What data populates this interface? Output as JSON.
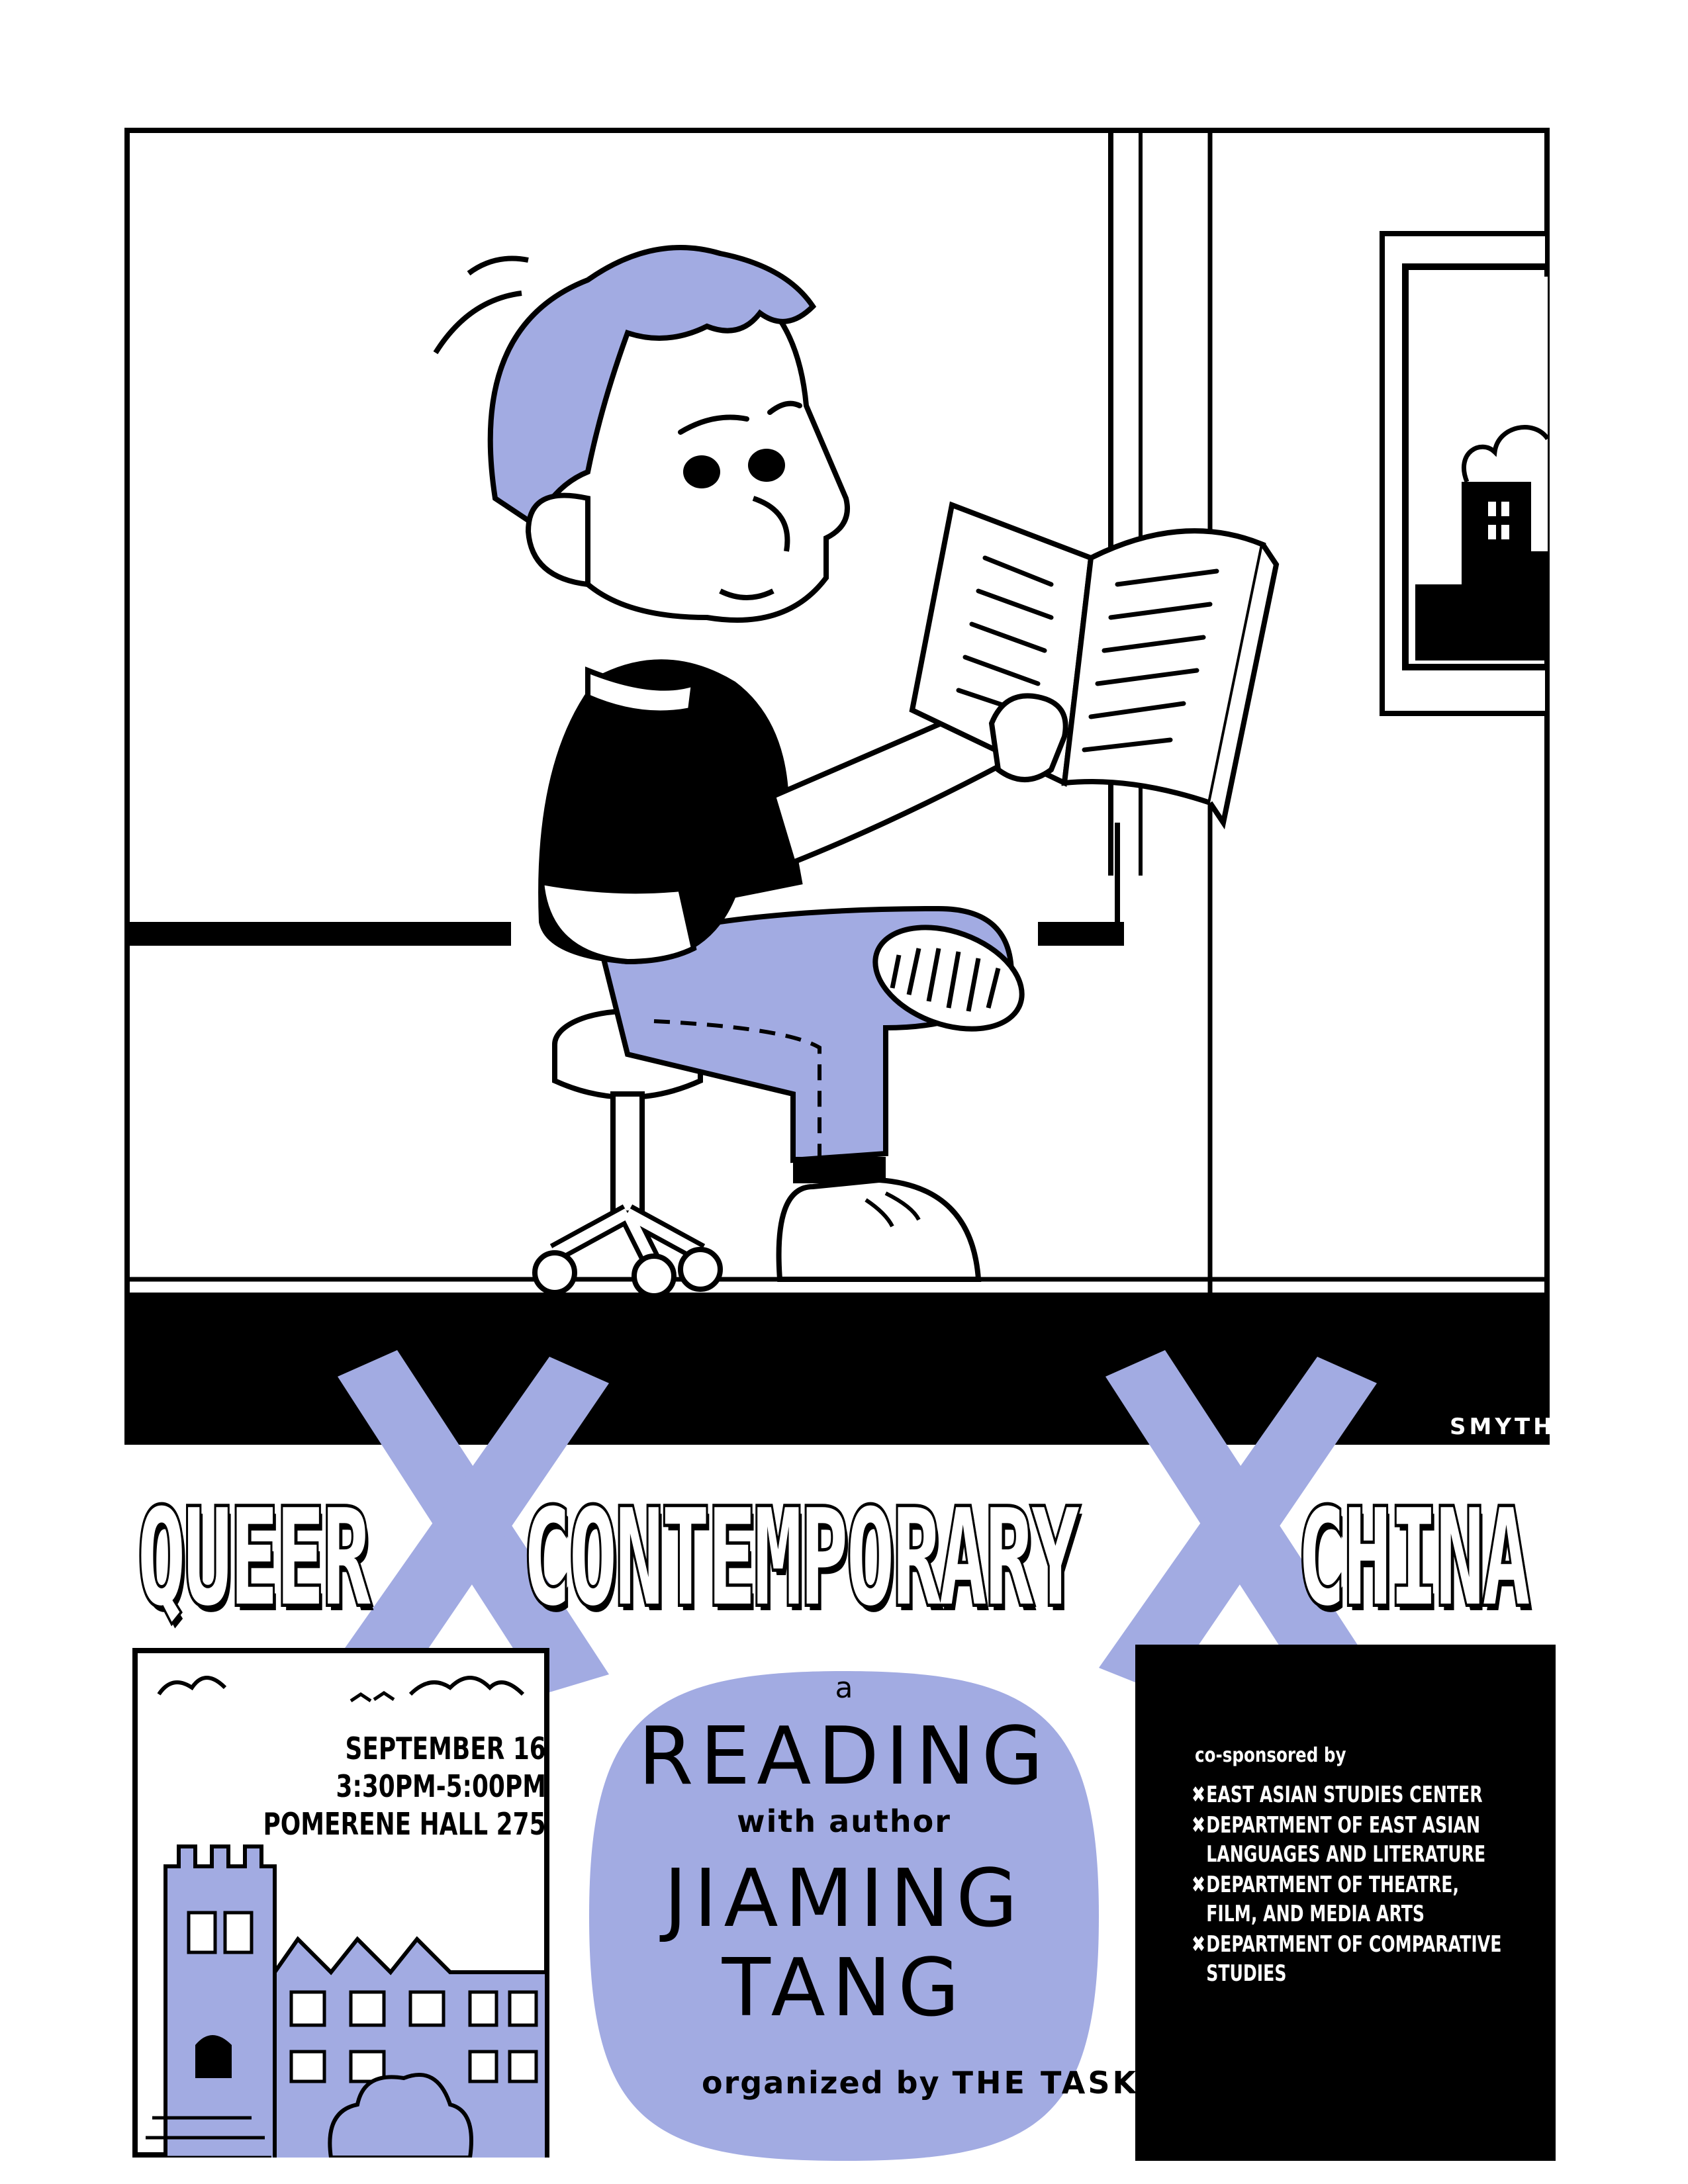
{
  "artist_credit": "SMYTH",
  "title_words": [
    "QUEER",
    "CONTEMPORARY",
    "CHINA"
  ],
  "event": {
    "date": "SEPTEMBER 16",
    "time": "3:30PM-5:00PM",
    "venue": "POMERENE HALL 275"
  },
  "reading": {
    "article": "a",
    "word": "READING",
    "with_author": "with author",
    "author_first": "JIAMING",
    "author_last": "TANG"
  },
  "sponsors": {
    "heading": "co-sponsored by",
    "items": [
      {
        "line1": "EAST ASIAN STUDIES CENTER",
        "line2": ""
      },
      {
        "line1": "DEPARTMENT OF EAST ASIAN",
        "line2": "LANGUAGES AND LITERATURE"
      },
      {
        "line1": "DEPARTMENT OF THEATRE,",
        "line2": "FILM, AND MEDIA ARTS"
      },
      {
        "line1": "DEPARTMENT OF COMPARATIVE",
        "line2": "STUDIES"
      }
    ]
  },
  "organizer": {
    "prefix": "organized by",
    "name": "THE TASK OF THE CURATOR"
  },
  "colors": {
    "accent": "#a2abe2",
    "ink": "#000000",
    "paper": "#ffffff"
  }
}
